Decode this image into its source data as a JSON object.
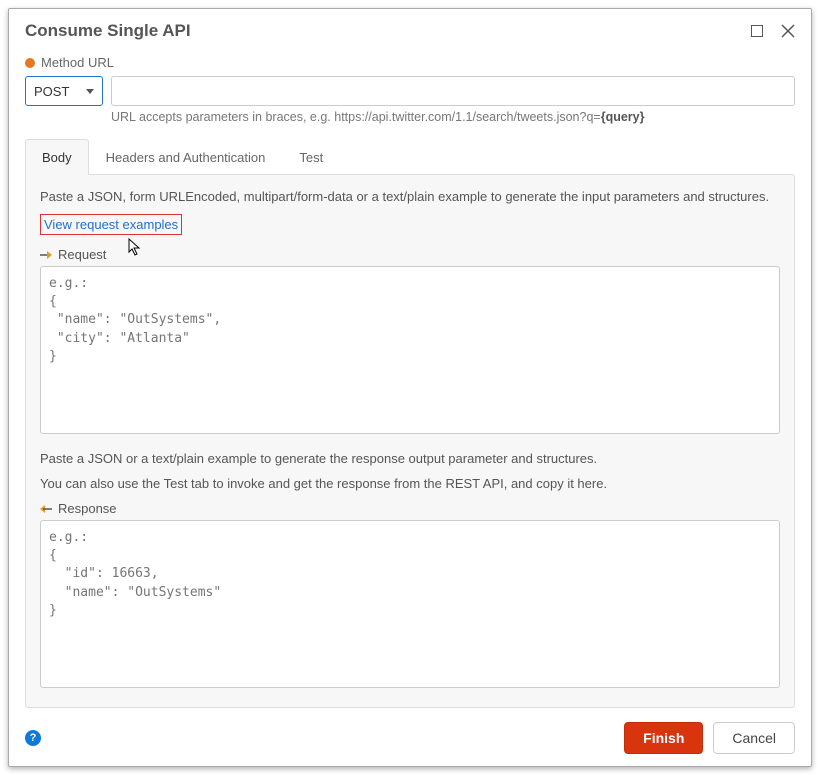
{
  "window": {
    "title": "Consume Single API"
  },
  "method_url": {
    "label": "Method URL",
    "method": "POST",
    "url_value": "",
    "hint_prefix": "URL accepts parameters in braces, e.g. https://api.twitter.com/1.1/search/tweets.json?q=",
    "hint_bold": "{query}"
  },
  "tabs": [
    {
      "label": "Body",
      "active": true
    },
    {
      "label": "Headers and Authentication",
      "active": false
    },
    {
      "label": "Test",
      "active": false
    }
  ],
  "body_tab": {
    "req_instr": "Paste a JSON, form URLEncoded, multipart/form-data or a text/plain example to generate the input parameters and structures.",
    "view_examples": "View request examples",
    "request_label": "Request",
    "request_placeholder": "e.g.:\n{\n \"name\": \"OutSystems\",\n \"city\": \"Atlanta\"\n}",
    "resp_instr1": "Paste a JSON or a text/plain example to generate the response output parameter and structures.",
    "resp_instr2": "You can also use the Test tab to invoke and get the response from the REST API, and copy it here.",
    "response_label": "Response",
    "response_placeholder": "e.g.:\n{\n  \"id\": 16663,\n  \"name\": \"OutSystems\"\n}"
  },
  "footer": {
    "finish": "Finish",
    "cancel": "Cancel"
  }
}
